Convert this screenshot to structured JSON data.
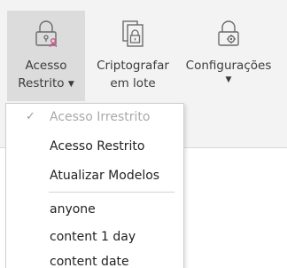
{
  "ribbon": {
    "buttons": [
      {
        "label_line1": "Acesso",
        "label_line2": "Restrito",
        "icon": "lock-user-icon"
      },
      {
        "label_line1": "Criptografar",
        "label_line2": "em lote",
        "icon": "encrypt-documents-icon"
      },
      {
        "label_line1": "Configurações",
        "label_line2": "",
        "icon": "lock-gear-icon"
      }
    ]
  },
  "menu": {
    "items": [
      {
        "label": "Acesso Irrestrito",
        "checked": true,
        "disabled": true
      },
      {
        "label": "Acesso Restrito"
      },
      {
        "label": "Atualizar Modelos"
      },
      {
        "label": "anyone"
      },
      {
        "label": "content 1 day"
      },
      {
        "label": "content date"
      }
    ]
  },
  "colors": {
    "icon_gray": "#6b6b6b",
    "icon_accent": "#c75a8a",
    "active_bg": "#dcdcdc"
  }
}
